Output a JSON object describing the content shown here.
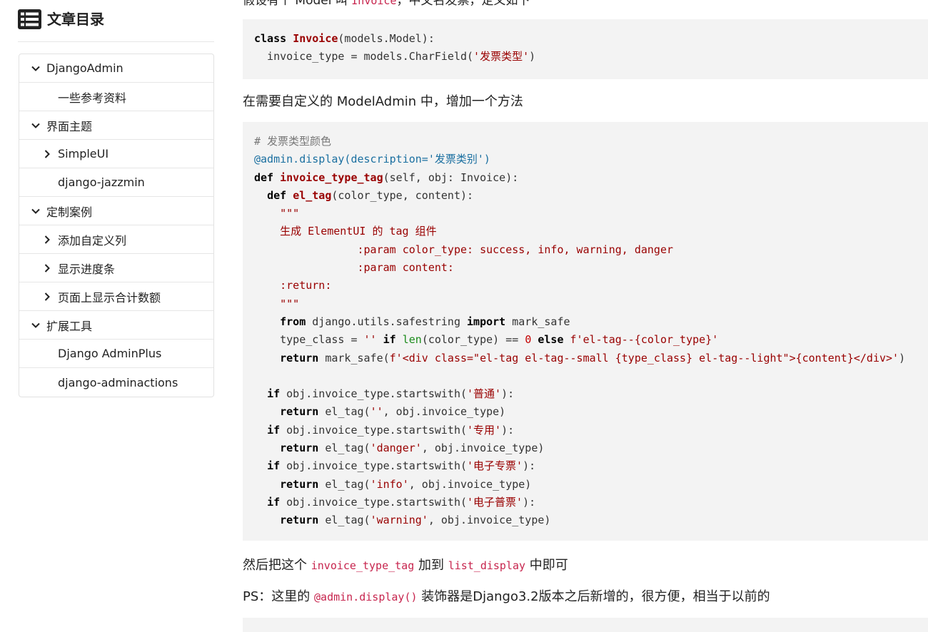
{
  "toc": {
    "title": "文章目录",
    "items": [
      {
        "label": "DjangoAdmin",
        "level": 1,
        "chevron": "down"
      },
      {
        "label": "一些参考资料",
        "level": 2,
        "chevron": "none"
      },
      {
        "label": "界面主题",
        "level": 1,
        "chevron": "down"
      },
      {
        "label": "SimpleUI",
        "level": 2,
        "chevron": "right"
      },
      {
        "label": "django-jazzmin",
        "level": 2,
        "chevron": "none"
      },
      {
        "label": "定制案例",
        "level": 1,
        "chevron": "down"
      },
      {
        "label": "添加自定义列",
        "level": 2,
        "chevron": "right"
      },
      {
        "label": "显示进度条",
        "level": 2,
        "chevron": "right"
      },
      {
        "label": "页面上显示合计数额",
        "level": 2,
        "chevron": "right"
      },
      {
        "label": "扩展工具",
        "level": 1,
        "chevron": "down"
      },
      {
        "label": "Django AdminPlus",
        "level": 2,
        "chevron": "none"
      },
      {
        "label": "django-adminactions",
        "level": 2,
        "chevron": "none"
      }
    ]
  },
  "content": {
    "top_partial": {
      "before": "假设有个 Model 叫 ",
      "code": "Invoice",
      "after": "，中文名发票，定义如下"
    },
    "code1": [
      [
        {
          "t": "class ",
          "c": "kw"
        },
        {
          "t": "Invoice",
          "c": "cls"
        },
        {
          "t": "(models.Model):",
          "c": ""
        }
      ],
      [
        {
          "t": "  invoice_type = models.CharField(",
          "c": ""
        },
        {
          "t": "'发票类型'",
          "c": "str"
        },
        {
          "t": ")",
          "c": ""
        }
      ]
    ],
    "para1": "在需要自定义的 ModelAdmin 中，增加一个方法",
    "code2": [
      [
        {
          "t": "# 发票类型颜色",
          "c": "cmt"
        }
      ],
      [
        {
          "t": "@admin.display(description=",
          "c": "dec"
        },
        {
          "t": "'发票类别'",
          "c": "dec"
        },
        {
          "t": ")",
          "c": "dec"
        }
      ],
      [
        {
          "t": "def ",
          "c": "kw"
        },
        {
          "t": "invoice_type_tag",
          "c": "fn"
        },
        {
          "t": "(self, obj: Invoice):",
          "c": ""
        }
      ],
      [
        {
          "t": "  ",
          "c": ""
        },
        {
          "t": "def ",
          "c": "kw"
        },
        {
          "t": "el_tag",
          "c": "fn"
        },
        {
          "t": "(color_type, content):",
          "c": ""
        }
      ],
      [
        {
          "t": "    \"\"\"",
          "c": "str"
        }
      ],
      [
        {
          "t": "    生成 ElementUI 的 tag 组件",
          "c": "str"
        }
      ],
      [
        {
          "t": "                :param color_type: success, info, warning, danger",
          "c": "str"
        }
      ],
      [
        {
          "t": "                :param content:",
          "c": "str"
        }
      ],
      [
        {
          "t": "    :return:",
          "c": "str"
        }
      ],
      [
        {
          "t": "    \"\"\"",
          "c": "str"
        }
      ],
      [
        {
          "t": "    ",
          "c": ""
        },
        {
          "t": "from",
          "c": "kw"
        },
        {
          "t": " django.utils.safestring ",
          "c": ""
        },
        {
          "t": "import",
          "c": "kw"
        },
        {
          "t": " mark_safe",
          "c": ""
        }
      ],
      [
        {
          "t": "    type_class = ",
          "c": ""
        },
        {
          "t": "''",
          "c": "str"
        },
        {
          "t": " ",
          "c": ""
        },
        {
          "t": "if",
          "c": "kw"
        },
        {
          "t": " ",
          "c": ""
        },
        {
          "t": "len",
          "c": "bi"
        },
        {
          "t": "(color_type) == ",
          "c": ""
        },
        {
          "t": "0",
          "c": "num"
        },
        {
          "t": " ",
          "c": ""
        },
        {
          "t": "else",
          "c": "kw"
        },
        {
          "t": " ",
          "c": ""
        },
        {
          "t": "f'el-tag--{color_type}'",
          "c": "str"
        }
      ],
      [
        {
          "t": "    ",
          "c": ""
        },
        {
          "t": "return",
          "c": "kw"
        },
        {
          "t": " mark_safe(",
          "c": ""
        },
        {
          "t": "f'<div class=\"el-tag el-tag--small {type_class} el-tag--light\">{content}</div>'",
          "c": "str"
        },
        {
          "t": ")",
          "c": ""
        }
      ],
      [
        {
          "t": "",
          "c": ""
        }
      ],
      [
        {
          "t": "  ",
          "c": ""
        },
        {
          "t": "if",
          "c": "kw"
        },
        {
          "t": " obj.invoice_type.startswith(",
          "c": ""
        },
        {
          "t": "'普通'",
          "c": "str"
        },
        {
          "t": "):",
          "c": ""
        }
      ],
      [
        {
          "t": "    ",
          "c": ""
        },
        {
          "t": "return",
          "c": "kw"
        },
        {
          "t": " el_tag(",
          "c": ""
        },
        {
          "t": "''",
          "c": "str"
        },
        {
          "t": ", obj.invoice_type)",
          "c": ""
        }
      ],
      [
        {
          "t": "  ",
          "c": ""
        },
        {
          "t": "if",
          "c": "kw"
        },
        {
          "t": " obj.invoice_type.startswith(",
          "c": ""
        },
        {
          "t": "'专用'",
          "c": "str"
        },
        {
          "t": "):",
          "c": ""
        }
      ],
      [
        {
          "t": "    ",
          "c": ""
        },
        {
          "t": "return",
          "c": "kw"
        },
        {
          "t": " el_tag(",
          "c": ""
        },
        {
          "t": "'danger'",
          "c": "str"
        },
        {
          "t": ", obj.invoice_type)",
          "c": ""
        }
      ],
      [
        {
          "t": "  ",
          "c": ""
        },
        {
          "t": "if",
          "c": "kw"
        },
        {
          "t": " obj.invoice_type.startswith(",
          "c": ""
        },
        {
          "t": "'电子专票'",
          "c": "str"
        },
        {
          "t": "):",
          "c": ""
        }
      ],
      [
        {
          "t": "    ",
          "c": ""
        },
        {
          "t": "return",
          "c": "kw"
        },
        {
          "t": " el_tag(",
          "c": ""
        },
        {
          "t": "'info'",
          "c": "str"
        },
        {
          "t": ", obj.invoice_type)",
          "c": ""
        }
      ],
      [
        {
          "t": "  ",
          "c": ""
        },
        {
          "t": "if",
          "c": "kw"
        },
        {
          "t": " obj.invoice_type.startswith(",
          "c": ""
        },
        {
          "t": "'电子普票'",
          "c": "str"
        },
        {
          "t": "):",
          "c": ""
        }
      ],
      [
        {
          "t": "    ",
          "c": ""
        },
        {
          "t": "return",
          "c": "kw"
        },
        {
          "t": " el_tag(",
          "c": ""
        },
        {
          "t": "'warning'",
          "c": "str"
        },
        {
          "t": ", obj.invoice_type)",
          "c": ""
        }
      ]
    ],
    "para2": {
      "before": "然后把这个 ",
      "code1": "invoice_type_tag",
      "middle": " 加到 ",
      "code2": "list_display",
      "after": " 中即可"
    },
    "para3": {
      "before": "PS：这里的 ",
      "code": "@admin.display()",
      "after": " 装饰器是Django3.2版本之后新增的，很方便，相当于以前的"
    }
  },
  "colors": {
    "code_bg": "#f3f3f3",
    "inline_code": "#c7254e",
    "string": "#990000",
    "decorator": "#1a6fa0"
  }
}
